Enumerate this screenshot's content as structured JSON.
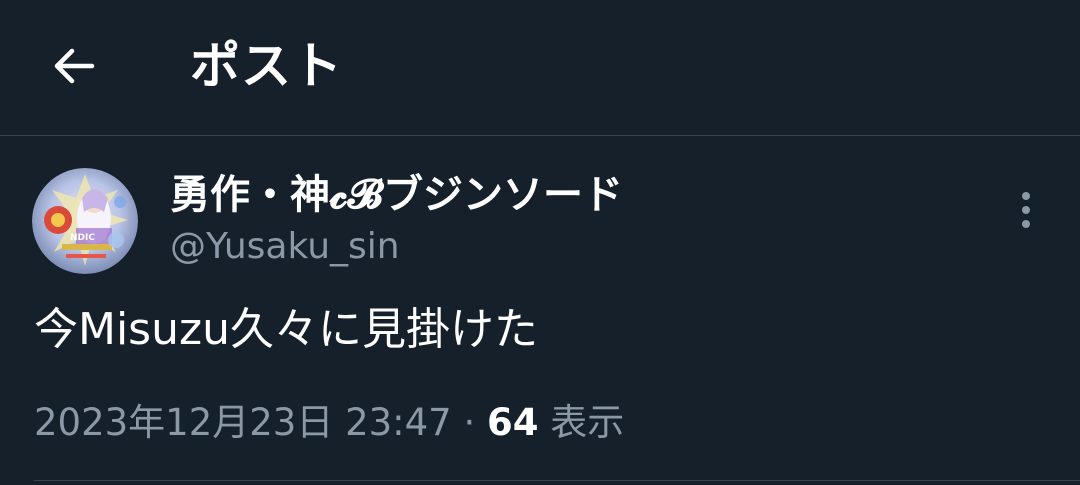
{
  "header": {
    "title": "ポスト",
    "back_icon": "arrow-left-icon"
  },
  "author": {
    "display_name": "勇作・神𝓬𝓑ブジンソード",
    "handle": "@Yusaku_sin",
    "avatar": "anime-artwork-avatar"
  },
  "tweet": {
    "text": "今Misuzu久々に見掛けた",
    "more_icon": "more-vertical-icon"
  },
  "meta": {
    "timestamp": "2023年12月23日 23:47",
    "separator": " · ",
    "views_count": "64",
    "views_label": " 表示"
  },
  "colors": {
    "background": "#15202b",
    "primary_text": "#ffffff",
    "secondary_text": "#8b98a5",
    "border": "#38444d"
  }
}
